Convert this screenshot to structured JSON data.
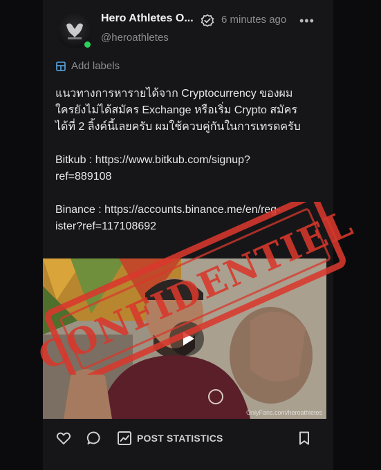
{
  "post": {
    "author_name": "Hero Athletes O...",
    "handle": "@heroathletes",
    "time_ago": "6 minutes ago",
    "more_label": "•••",
    "add_labels": "Add labels",
    "text_lines": [
      "แนวทางการหารายได้จาก Cryptocurrency ของผม",
      "ใครยังไม่ได้สมัคร Exchange หรือเริ่ม Crypto สมัคร",
      "ได้ที่ 2 ลิ้งค์นี้เลยครับ ผมใช้ควบคู่กันในการเทรดครับ",
      "Bitkub : https://www.bitkub.com/signup?",
      "ref=889108",
      "Binance : https://accounts.binance.me/en/reg-",
      "ister?ref=117108692"
    ],
    "media_watermark": "OnlyFans.com/heroathletes",
    "stamp_text": "CONFIDENTIEL"
  },
  "footer": {
    "post_statistics": "POST STATISTICS"
  },
  "icons": {
    "like": "heart-icon",
    "comment": "comment-icon",
    "stats": "stats-chart-icon",
    "bookmark": "bookmark-icon",
    "verified": "verified-badge-icon",
    "labels": "label-icon",
    "play": "play-icon"
  },
  "colors": {
    "background": "#0b0b0d",
    "card": "#161618",
    "muted_text": "#8d8d92",
    "label_blue": "#5aa8e6",
    "stamp_red": "#d8382c",
    "online_green": "#2bd15a"
  }
}
